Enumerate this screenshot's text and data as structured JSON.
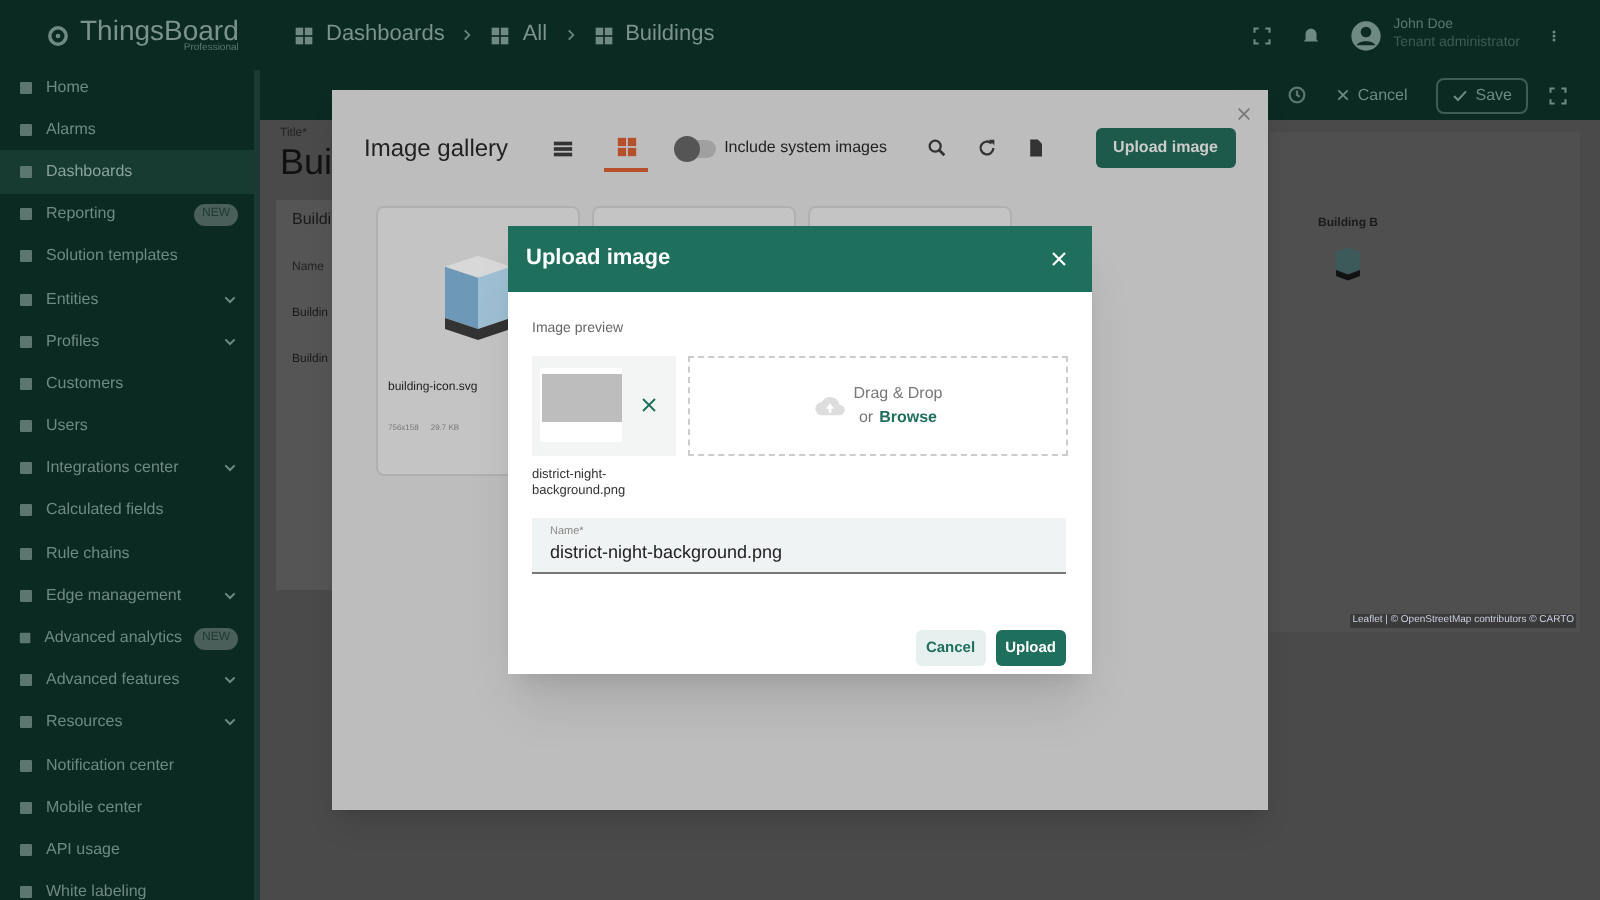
{
  "app": {
    "logo": "ThingsBoard",
    "logo_subtitle": "Professional"
  },
  "breadcrumbs": [
    "Dashboards",
    "All",
    "Buildings"
  ],
  "user": {
    "name": "John Doe",
    "role": "Tenant administrator"
  },
  "sidebar": {
    "items": [
      {
        "label": "Home",
        "selected": false,
        "expandable": false
      },
      {
        "label": "Alarms",
        "selected": false,
        "expandable": false
      },
      {
        "label": "Dashboards",
        "selected": true,
        "expandable": false
      },
      {
        "label": "Reporting",
        "selected": false,
        "expandable": false,
        "badge": "NEW"
      },
      {
        "label": "Solution templates",
        "selected": false,
        "expandable": false
      },
      {
        "label": "Entities",
        "selected": false,
        "expandable": true
      },
      {
        "label": "Profiles",
        "selected": false,
        "expandable": true
      },
      {
        "label": "Customers",
        "selected": false,
        "expandable": false
      },
      {
        "label": "Users",
        "selected": false,
        "expandable": false
      },
      {
        "label": "Integrations center",
        "selected": false,
        "expandable": true
      },
      {
        "label": "Calculated fields",
        "selected": false,
        "expandable": false
      },
      {
        "label": "Rule chains",
        "selected": false,
        "expandable": false
      },
      {
        "label": "Edge management",
        "selected": false,
        "expandable": true
      },
      {
        "label": "Advanced analytics",
        "selected": false,
        "expandable": false,
        "badge": "NEW"
      },
      {
        "label": "Advanced features",
        "selected": false,
        "expandable": true
      },
      {
        "label": "Resources",
        "selected": false,
        "expandable": true
      },
      {
        "label": "Notification center",
        "selected": false,
        "expandable": false
      },
      {
        "label": "Mobile center",
        "selected": false,
        "expandable": false
      },
      {
        "label": "API usage",
        "selected": false,
        "expandable": false
      },
      {
        "label": "White labeling",
        "selected": false,
        "expandable": false
      }
    ]
  },
  "toolbar": {
    "cancel": "Cancel",
    "save": "Save"
  },
  "dashboard": {
    "title_label": "Title*",
    "title": "Bui",
    "widget_title": "Buildi",
    "column": "Name",
    "rows": [
      "Buildin",
      "Buildin"
    ]
  },
  "map": {
    "marker_label": "Building B",
    "attribution": "Leaflet | © OpenStreetMap contributors © CARTO"
  },
  "gallery": {
    "title": "Image gallery",
    "views": [
      {
        "kind": "list",
        "selected": false
      },
      {
        "kind": "grid",
        "selected": true
      }
    ],
    "include_system_images": {
      "label": "Include system images",
      "on": false
    },
    "upload_button": "Upload image",
    "cards": [
      {
        "kind": "image",
        "name": "building-icon.svg",
        "size": "756x158",
        "file_size": "29.7 KB"
      },
      {
        "kind": "blank"
      },
      {
        "kind": "blank"
      }
    ]
  },
  "upload_dialog": {
    "title": "Upload image",
    "preview_label": "Image preview",
    "file_name": "district-night-background.png",
    "drop_text": "Drag & Drop",
    "or_text": "or",
    "browse": "Browse",
    "name_field": {
      "label": "Name*",
      "value": "district-night-background.png"
    },
    "buttons": [
      {
        "kind": "secondary",
        "label": "Cancel"
      },
      {
        "kind": "primary",
        "label": "Upload"
      }
    ]
  }
}
